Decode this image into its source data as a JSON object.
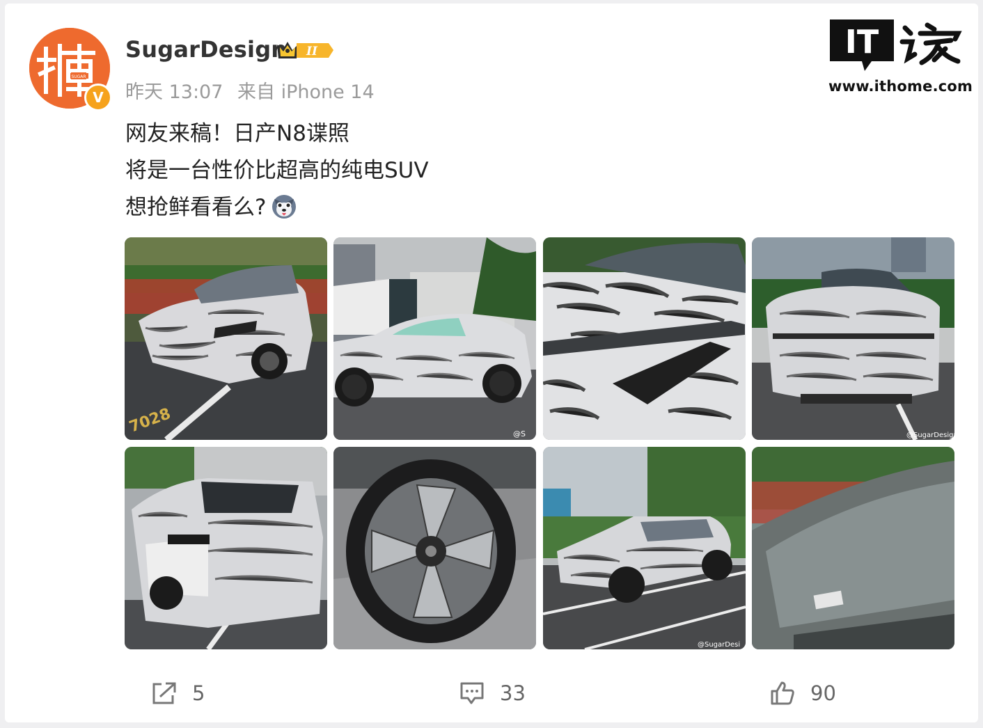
{
  "post": {
    "username": "SugarDesign",
    "vip_level": "II",
    "time": "昨天 13:07",
    "source": "来自 iPhone 14",
    "lines": [
      "网友来稿！日产N8谍照",
      "将是一台性价比超高的纯电SUV",
      "想抢鲜看看么?"
    ],
    "emoji": "dog-emoji"
  },
  "avatar": {
    "badge": "V",
    "text": "糖",
    "small_text": "SUGAR"
  },
  "watermark": {
    "logo_text": "IT",
    "url": "www.ithome.com"
  },
  "photos": [
    {
      "name": "photo-front-quarter",
      "caption": "",
      "watermark": ""
    },
    {
      "name": "photo-side-profile",
      "caption": "",
      "watermark": "@S"
    },
    {
      "name": "photo-front-closeup",
      "caption": "",
      "watermark": ""
    },
    {
      "name": "photo-front-view",
      "caption": "",
      "watermark": "@SugarDesign"
    },
    {
      "name": "photo-rear-quarter",
      "caption": "",
      "watermark": ""
    },
    {
      "name": "photo-wheel",
      "caption": "",
      "watermark": ""
    },
    {
      "name": "photo-parked-side",
      "caption": "",
      "watermark": "@SugarDesi"
    },
    {
      "name": "photo-windshield",
      "caption": "",
      "watermark": ""
    }
  ],
  "actions": {
    "repost_count": "5",
    "comment_count": "33",
    "like_count": "90"
  },
  "colors": {
    "avatar_bg": "#ee6a2e",
    "verified": "#f6a21c",
    "text": "#222222",
    "meta": "#9a9a9a"
  }
}
